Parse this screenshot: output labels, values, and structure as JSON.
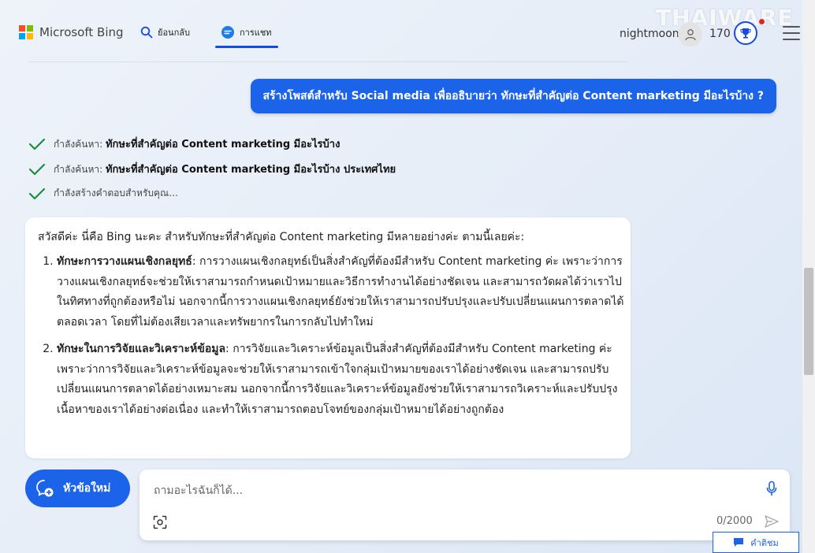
{
  "header": {
    "brand": "Microsoft Bing",
    "tabs": [
      {
        "label": "ย้อนกลับ",
        "icon": "search-icon"
      },
      {
        "label": "การแชท",
        "icon": "chat-icon",
        "active": true
      }
    ],
    "username": "nightmoon",
    "points": "170",
    "watermark": "THAIWARE"
  },
  "conversation": {
    "user_message": "สร้างโพสต์สำหรับ Social media เพื่ออธิบายว่า ทักษะที่สำคัญต่อ Content marketing มีอะไรบ้าง ?",
    "progress": [
      {
        "prefix": "กำลังค้นหา: ",
        "query": "ทักษะที่สำคัญต่อ Content marketing มีอะไรบ้าง"
      },
      {
        "prefix": "กำลังค้นหา: ",
        "query": "ทักษะที่สำคัญต่อ Content marketing มีอะไรบ้าง ประเทศไทย"
      },
      {
        "prefix": "กำลังสร้างคำตอบสำหรับคุณ…",
        "query": ""
      }
    ],
    "answer_intro": "สวัสดีค่ะ นี่คือ Bing นะคะ สำหรับทักษะที่สำคัญต่อ Content marketing มีหลายอย่างค่ะ ตามนี้เลยค่ะ:",
    "answer_items": [
      {
        "title": "ทักษะการวางแผนเชิงกลยุทธ์",
        "text": ": การวางแผนเชิงกลยุทธ์เป็นสิ่งสำคัญที่ต้องมีสำหรับ Content marketing ค่ะ เพราะว่าการวางแผนเชิงกลยุทธ์จะช่วยให้เราสามารถกำหนดเป้าหมายและวิธีการทำงานได้อย่างชัดเจน และสามารถวัดผลได้ว่าเราไปในทิศทางที่ถูกต้องหรือไม่ นอกจากนี้การวางแผนเชิงกลยุทธ์ยังช่วยให้เราสามารถปรับปรุงและปรับเปลี่ยนแผนการตลาดได้ตลอดเวลา โดยที่ไม่ต้องเสียเวลาและทรัพยากรในการกลับไปทำใหม่"
      },
      {
        "title": "ทักษะในการวิจัยและวิเคราะห์ข้อมูล",
        "text": ": การวิจัยและวิเคราะห์ข้อมูลเป็นสิ่งสำคัญที่ต้องมีสำหรับ Content marketing ค่ะ เพราะว่าการวิจัยและวิเคราะห์ข้อมูลจะช่วยให้เราสามารถเข้าใจกลุ่มเป้าหมายของเราได้อย่างชัดเจน และสามารถปรับเปลี่ยนแผนการตลาดได้อย่างเหมาะสม นอกจากนี้การวิจัยและวิเคราะห์ข้อมูลยังช่วยให้เราสามารถวิเคราะห์และปรับปรุงเนื้อหาของเราได้อย่างต่อเนื่อง และทำให้เราสามารถตอบโจทย์ของกลุ่มเป้าหมายได้อย่างถูกต้อง"
      }
    ]
  },
  "composer": {
    "new_topic_label": "หัวข้อใหม่",
    "placeholder": "ถามอะไรฉันก็ได้...",
    "char_count": "0/2000"
  },
  "feedback_label": "คำติชม",
  "colors": {
    "accent": "#1b63e8",
    "check": "#1a8f3c"
  }
}
